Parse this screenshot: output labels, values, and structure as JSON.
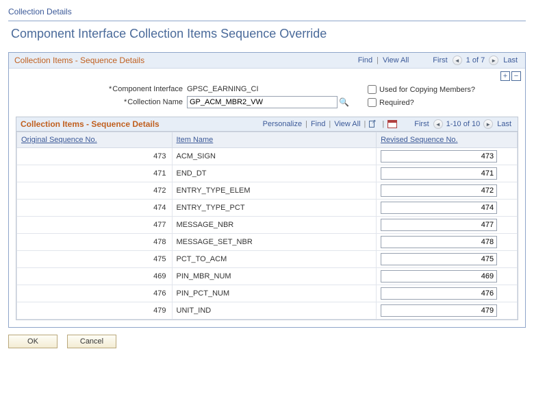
{
  "page": {
    "tab": "Collection Details",
    "title": "Component Interface Collection Items Sequence Override"
  },
  "scroll": {
    "title": "Collection Items - Sequence Details",
    "find": "Find",
    "view_all": "View All",
    "first": "First",
    "nav_text": "1 of 7",
    "last": "Last"
  },
  "form": {
    "ci_label": "Component Interface",
    "ci_value": "GPSC_EARNING_CI",
    "coll_label": "Collection Name",
    "coll_value": "GP_ACM_MBR2_VW",
    "cb_copying": "Used for Copying Members?",
    "cb_required": "Required?"
  },
  "grid": {
    "title": "Collection Items - Sequence Details",
    "personalize": "Personalize",
    "find": "Find",
    "view_all": "View All",
    "first": "First",
    "nav_text": "1-10 of 10",
    "last": "Last",
    "cols": {
      "orig": "Original Sequence No.",
      "name": "Item Name",
      "rev": "Revised Sequence No."
    },
    "rows": [
      {
        "orig": "473",
        "name": "ACM_SIGN",
        "rev": "473"
      },
      {
        "orig": "471",
        "name": "END_DT",
        "rev": "471"
      },
      {
        "orig": "472",
        "name": "ENTRY_TYPE_ELEM",
        "rev": "472"
      },
      {
        "orig": "474",
        "name": "ENTRY_TYPE_PCT",
        "rev": "474"
      },
      {
        "orig": "477",
        "name": "MESSAGE_NBR",
        "rev": "477"
      },
      {
        "orig": "478",
        "name": "MESSAGE_SET_NBR",
        "rev": "478"
      },
      {
        "orig": "475",
        "name": "PCT_TO_ACM",
        "rev": "475"
      },
      {
        "orig": "469",
        "name": "PIN_MBR_NUM",
        "rev": "469"
      },
      {
        "orig": "476",
        "name": "PIN_PCT_NUM",
        "rev": "476"
      },
      {
        "orig": "479",
        "name": "UNIT_IND",
        "rev": "479"
      }
    ]
  },
  "buttons": {
    "ok": "OK",
    "cancel": "Cancel"
  }
}
